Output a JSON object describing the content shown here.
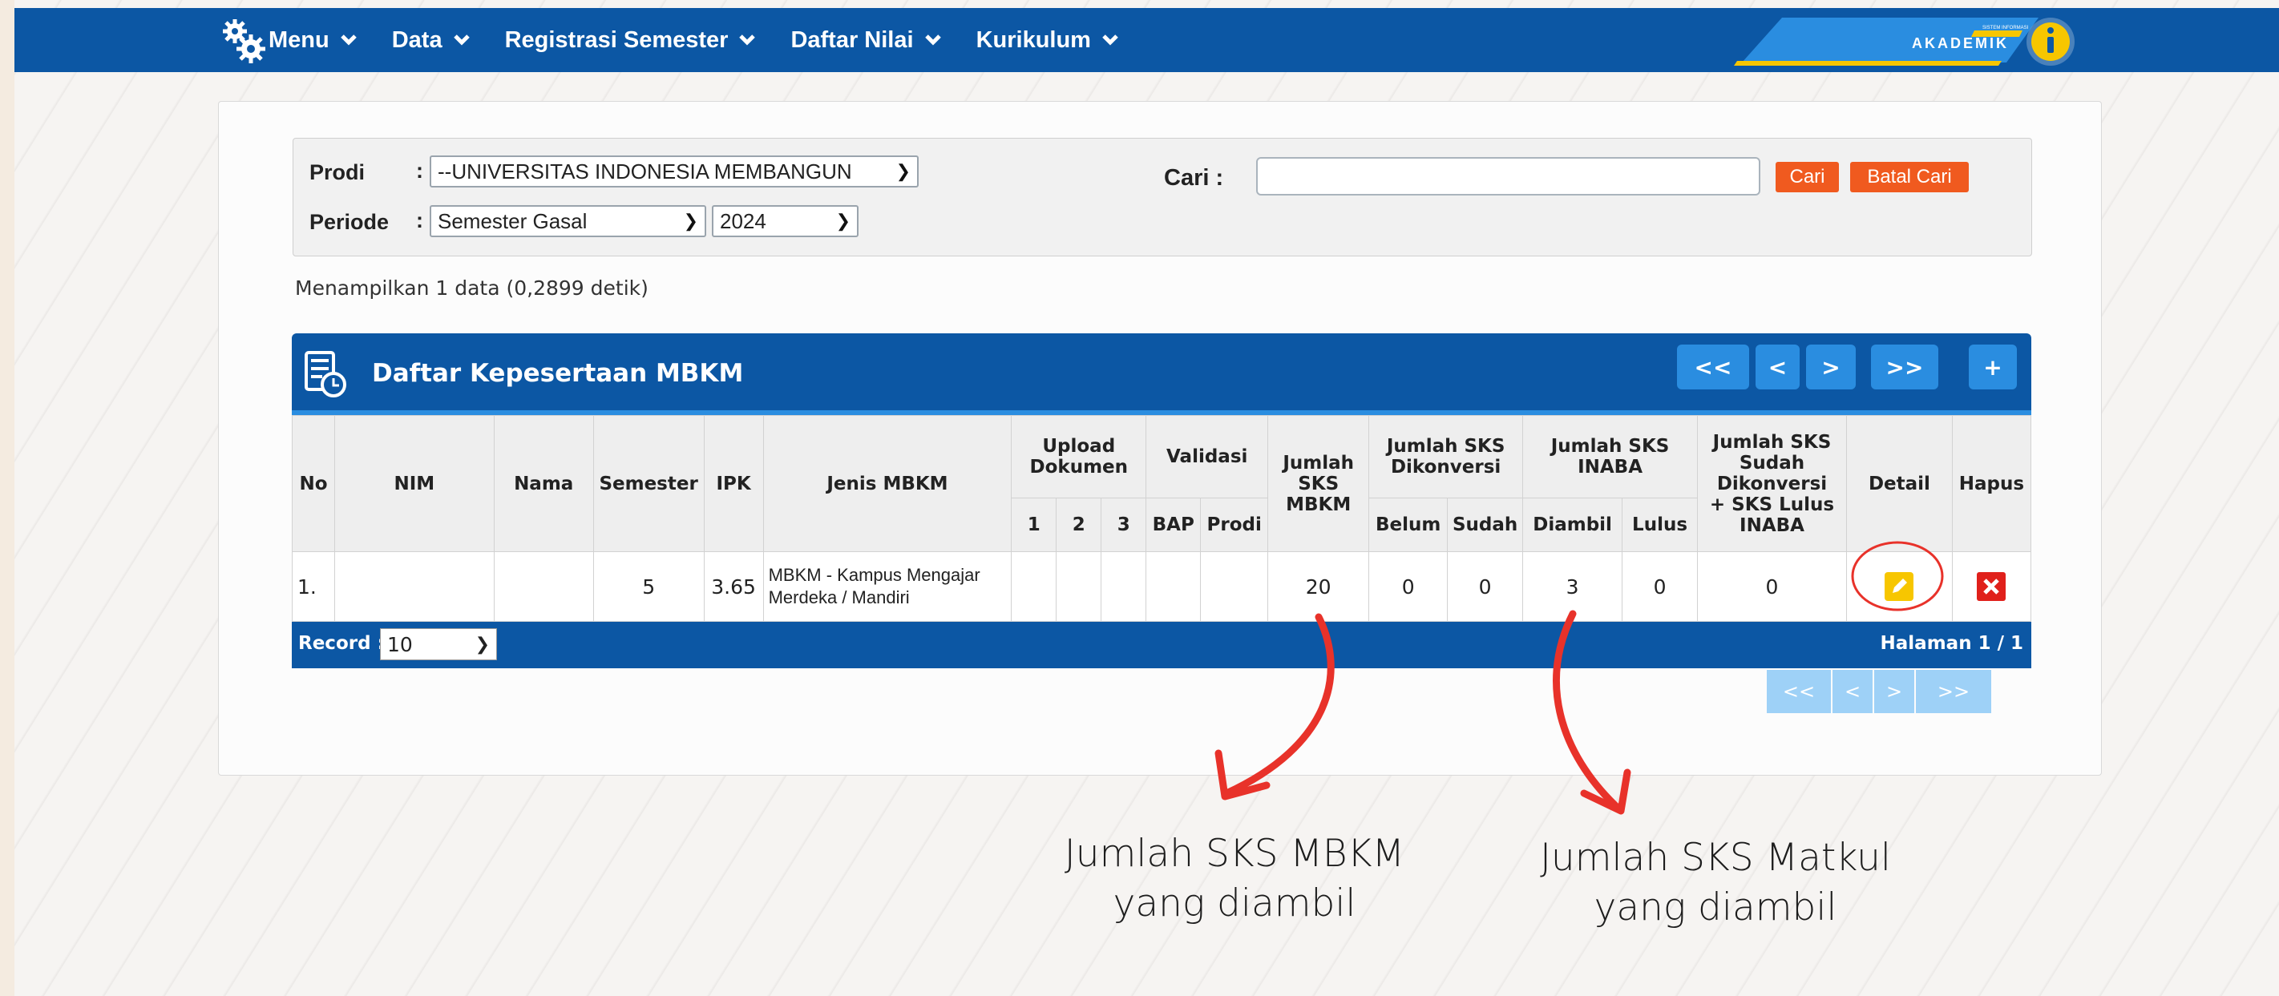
{
  "navbar": {
    "menu_items": [
      {
        "label": "Menu"
      },
      {
        "label": "Data"
      },
      {
        "label": "Registrasi Semester"
      },
      {
        "label": "Daftar Nilai"
      },
      {
        "label": "Kurikulum"
      }
    ],
    "brand_text": "AKADEMIK",
    "brand_small": "SISTEM INFORMASI"
  },
  "filters": {
    "prodi_label": "Prodi",
    "periode_label": "Periode",
    "colon": ":",
    "prodi_value": "--UNIVERSITAS INDONESIA MEMBANGUN",
    "semester_value": "Semester Gasal",
    "year_value": "2024",
    "search_label": "Cari :",
    "search_value": "",
    "search_button": "Cari",
    "cancel_button": "Batal Cari"
  },
  "info_text": "Menampilkan 1 data (0,2899 detik)",
  "table": {
    "title": "Daftar Kepesertaan MBKM",
    "pager": [
      "<<",
      "<",
      ">",
      ">>"
    ],
    "add_label": "+",
    "headers": {
      "no": "No",
      "nim": "NIM",
      "nama": "Nama",
      "semester": "Semester",
      "ipk": "IPK",
      "jenis": "Jenis MBKM",
      "upload": "Upload Dokumen",
      "u1": "1",
      "u2": "2",
      "u3": "3",
      "validasi": "Validasi",
      "bap": "BAP",
      "prodi": "Prodi",
      "jumlah_sks_mbkm": "Jumlah SKS MBKM",
      "dikonversi": "Jumlah SKS Dikonversi",
      "belum": "Belum",
      "sudah": "Sudah",
      "inaba": "Jumlah SKS INABA",
      "diambil": "Diambil",
      "lulus": "Lulus",
      "total": "Jumlah SKS Sudah Dikonversi + SKS Lulus INABA",
      "detail": "Detail",
      "hapus": "Hapus"
    },
    "rows": [
      {
        "no": "1.",
        "nim": "",
        "nama": "",
        "semester": "5",
        "ipk": "3.65",
        "jenis": "MBKM - Kampus Mengajar Merdeka / Mandiri",
        "u1": "",
        "u2": "",
        "u3": "",
        "bap": "",
        "prodi": "",
        "sks_mbkm": "20",
        "belum": "0",
        "sudah": "0",
        "diambil": "3",
        "lulus": "0",
        "total": "0"
      }
    ],
    "record_label": "Record :",
    "record_value": "10",
    "page_info": "Halaman 1 / 1",
    "bottom_pager": [
      "<<",
      "<",
      ">",
      ">>"
    ]
  },
  "annotations": {
    "left_line1": "Jumlah SKS MBKM",
    "left_line2": "yang diambil",
    "right_line1": "Jumlah SKS Matkul",
    "right_line2": "yang diambil"
  },
  "colors": {
    "nav_blue": "#0c57a4",
    "accent_blue": "#2a8de0",
    "button_orange": "#f05a1f",
    "edit_yellow": "#f7c600",
    "delete_red": "#e0201b",
    "annotation_red": "#e8322a"
  }
}
